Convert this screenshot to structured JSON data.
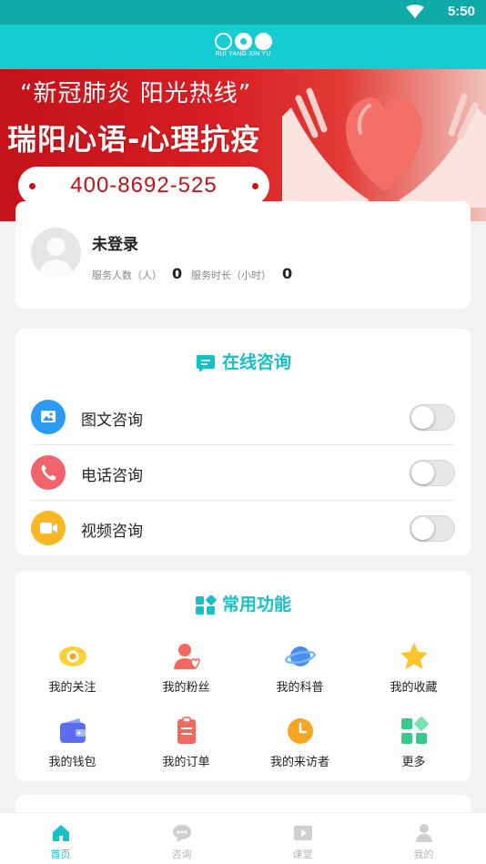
{
  "status_bar": {
    "time": "5:50",
    "icons": [
      "wifi-icon"
    ]
  },
  "app_bar": {
    "logo_subtext": "RUI YANG XIN YU"
  },
  "banner": {
    "line1": "“新冠肺炎 阳光热线”",
    "line2": "瑞阳心语-心理抗疫",
    "phone": "400-8692-525"
  },
  "user": {
    "name": "未登录",
    "served_label": "服务人数（人）",
    "served_value": "0",
    "duration_label": "服务时长（小时）",
    "duration_value": "0"
  },
  "consult": {
    "title": "在线咨询",
    "items": [
      {
        "label": "图文咨询",
        "icon": "image-chat-icon",
        "color": "#2a9af2",
        "enabled": false
      },
      {
        "label": "电话咨询",
        "icon": "phone-icon",
        "color": "#f2646b",
        "enabled": false
      },
      {
        "label": "视频咨询",
        "icon": "video-icon",
        "color": "#fbb722",
        "enabled": false
      }
    ]
  },
  "functions": {
    "title": "常用功能",
    "items": [
      {
        "label": "我的关注",
        "icon": "eye-icon"
      },
      {
        "label": "我的粉丝",
        "icon": "fans-icon"
      },
      {
        "label": "我的科普",
        "icon": "planet-icon"
      },
      {
        "label": "我的收藏",
        "icon": "star-icon"
      },
      {
        "label": "我的钱包",
        "icon": "wallet-icon"
      },
      {
        "label": "我的订单",
        "icon": "clipboard-icon"
      },
      {
        "label": "我的来访者",
        "icon": "clock-icon"
      },
      {
        "label": "更多",
        "icon": "more-grid-icon"
      }
    ]
  },
  "tabbar": {
    "tabs": [
      {
        "label": "首页",
        "icon": "home-icon",
        "active": true
      },
      {
        "label": "咨询",
        "icon": "chat-icon",
        "active": false
      },
      {
        "label": "课堂",
        "icon": "play-icon",
        "active": false
      },
      {
        "label": "我的",
        "icon": "person-icon",
        "active": false
      }
    ]
  },
  "colors": {
    "accent": "#16c1c6",
    "appbar": "#14ccd1",
    "status_bar": "#0fa9a7",
    "banner_red": "#c3121a"
  }
}
